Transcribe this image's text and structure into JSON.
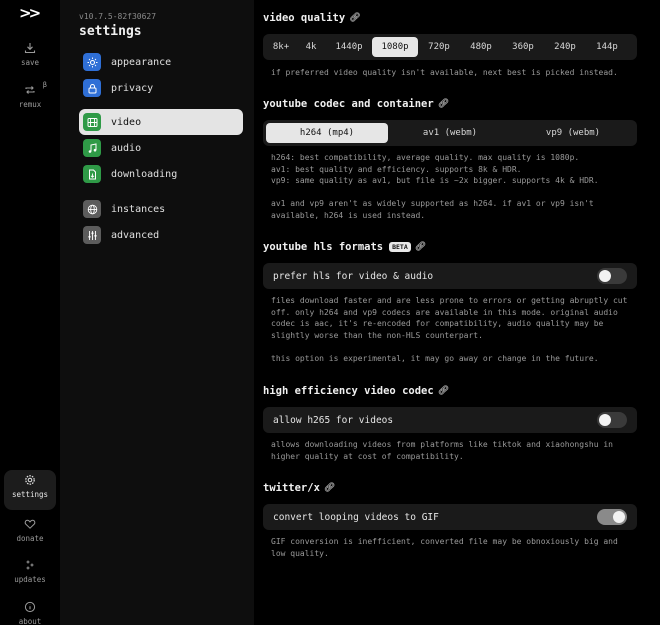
{
  "nav": {
    "logo": ">>",
    "save": "save",
    "remux": "remux",
    "remux_badge": "β",
    "settings": "settings",
    "donate": "donate",
    "updates": "updates",
    "about": "about"
  },
  "panel": {
    "version": "v10.7.5-82f30627",
    "title": "settings",
    "tabs": [
      {
        "label": "appearance",
        "icon": "sun-icon"
      },
      {
        "label": "privacy",
        "icon": "lock-icon"
      },
      {
        "label": "video",
        "icon": "film-icon"
      },
      {
        "label": "audio",
        "icon": "music-icon"
      },
      {
        "label": "downloading",
        "icon": "file-download-icon"
      },
      {
        "label": "instances",
        "icon": "globe-icon"
      },
      {
        "label": "advanced",
        "icon": "sliders-icon"
      }
    ]
  },
  "video_quality": {
    "title": "video quality",
    "options": [
      "8k+",
      "4k",
      "1440p",
      "1080p",
      "720p",
      "480p",
      "360p",
      "240p",
      "144p"
    ],
    "selected": "1080p",
    "desc": "if preferred video quality isn't available, next best is picked instead."
  },
  "codec": {
    "title": "youtube codec and container",
    "options": [
      "h264 (mp4)",
      "av1 (webm)",
      "vp9 (webm)"
    ],
    "selected": "h264 (mp4)",
    "desc1": "h264: best compatibility, average quality. max quality is 1080p.",
    "desc2": "av1: best quality and efficiency. supports 8k & HDR.",
    "desc3": "vp9: same quality as av1, but file is ~2x bigger. supports 4k & HDR.",
    "desc4": "av1 and vp9 aren't as widely supported as h264. if av1 or vp9 isn't available, h264 is used instead."
  },
  "hls": {
    "title": "youtube hls formats",
    "badge": "BETA",
    "toggle_label": "prefer hls for video & audio",
    "toggle_on": false,
    "desc1": "files download faster and are less prone to errors or getting abruptly cut off. only h264 and vp9 codecs are available in this mode. original audio codec is aac, it's re-encoded for compatibility, audio quality may be slightly worse than the non-HLS counterpart.",
    "desc2": "this option is experimental, it may go away or change in the future."
  },
  "hevc": {
    "title": "high efficiency video codec",
    "toggle_label": "allow h265 for videos",
    "toggle_on": false,
    "desc": "allows downloading videos from platforms like tiktok and xiaohongshu in higher quality at cost of compatibility."
  },
  "twitter": {
    "title": "twitter/x",
    "toggle_label": "convert looping videos to GIF",
    "toggle_on": true,
    "desc": "GIF conversion is inefficient, converted file may be obnoxiously big and low quality."
  }
}
